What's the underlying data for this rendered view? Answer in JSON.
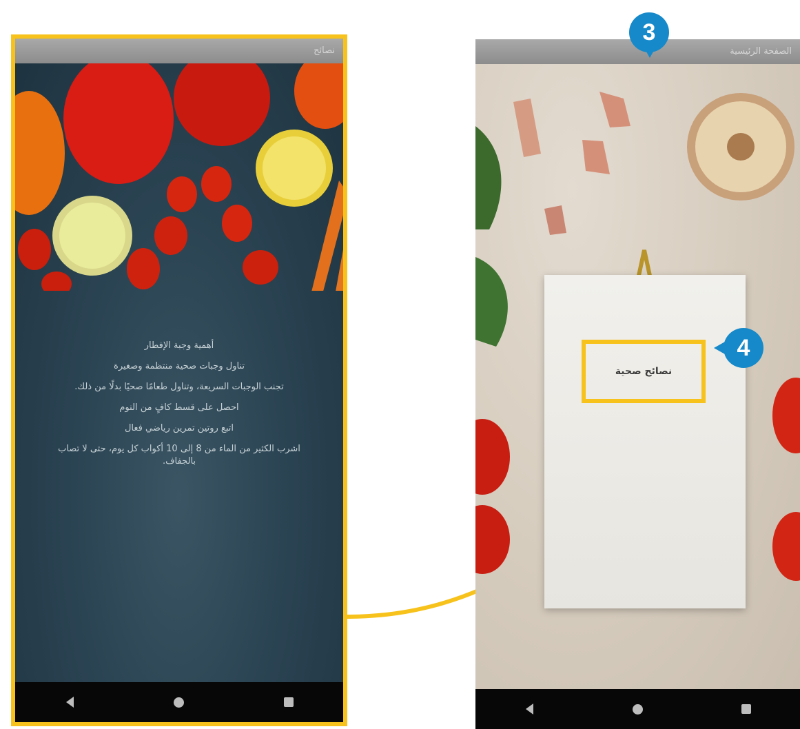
{
  "left_phone": {
    "status_title": "نصائح",
    "tips": [
      "أهمية وجبة الإفطار",
      "تناول وجبات صحية منتظمة وصغيرة",
      "تجنب الوجبات السريعة، وتناول طعامًا صحيًا بدلًا من ذلك.",
      "احصل على قسط كافٍ من النوم",
      "اتبع روتين تمرين رياضي فعال",
      "اشرب الكثير من الماء من 8 إلى 10 أكواب كل يوم، حتى لا تصاب",
      "بالجفاف."
    ]
  },
  "right_phone": {
    "status_title": "الصفحة الرئيسية",
    "title": "نصائح صحية"
  },
  "callouts": {
    "step3": "3",
    "step4": "4"
  },
  "nav": {
    "back": "back-icon",
    "home": "home-icon",
    "recents": "recents-icon"
  },
  "colors": {
    "highlight": "#f7c21b",
    "callout": "#1589c9",
    "board": "#2b4453",
    "nav_bar": "#070707"
  }
}
